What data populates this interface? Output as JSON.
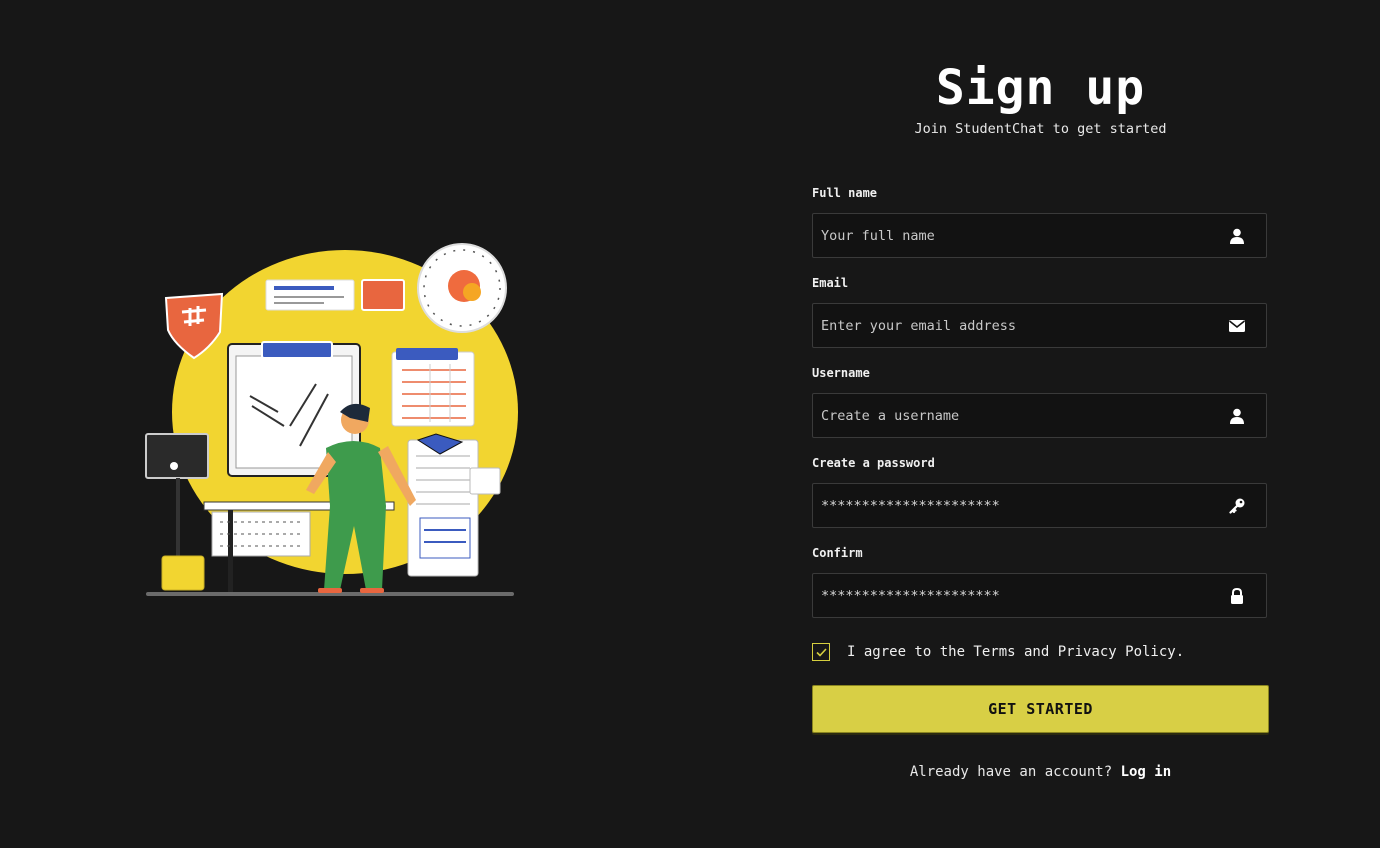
{
  "header": {
    "title": "Sign up",
    "subtitle": "Join StudentChat to get started"
  },
  "fields": [
    {
      "label": "Full name",
      "placeholder": "Your full name",
      "value": "",
      "icon": "user-icon"
    },
    {
      "label": "Email",
      "placeholder": "Enter your email address",
      "value": "",
      "icon": "envelope-icon"
    },
    {
      "label": "Username",
      "placeholder": "Create a username",
      "value": "",
      "icon": "user-icon"
    },
    {
      "label": "Create a password",
      "placeholder": "",
      "value": "**********************",
      "icon": "key-icon"
    },
    {
      "label": "Confirm",
      "placeholder": "",
      "value": "**********************",
      "icon": "lock-icon"
    }
  ],
  "terms": {
    "checked": true,
    "text": "I agree to the Terms and Privacy Policy."
  },
  "submit": {
    "label": "GET STARTED"
  },
  "footer": {
    "prompt": "Already have an account?",
    "link": "Log in"
  },
  "colors": {
    "background": "#171717",
    "accent": "#d8cf45",
    "illustration_circle": "#f2d530",
    "figure_green": "#3e9b4c"
  }
}
